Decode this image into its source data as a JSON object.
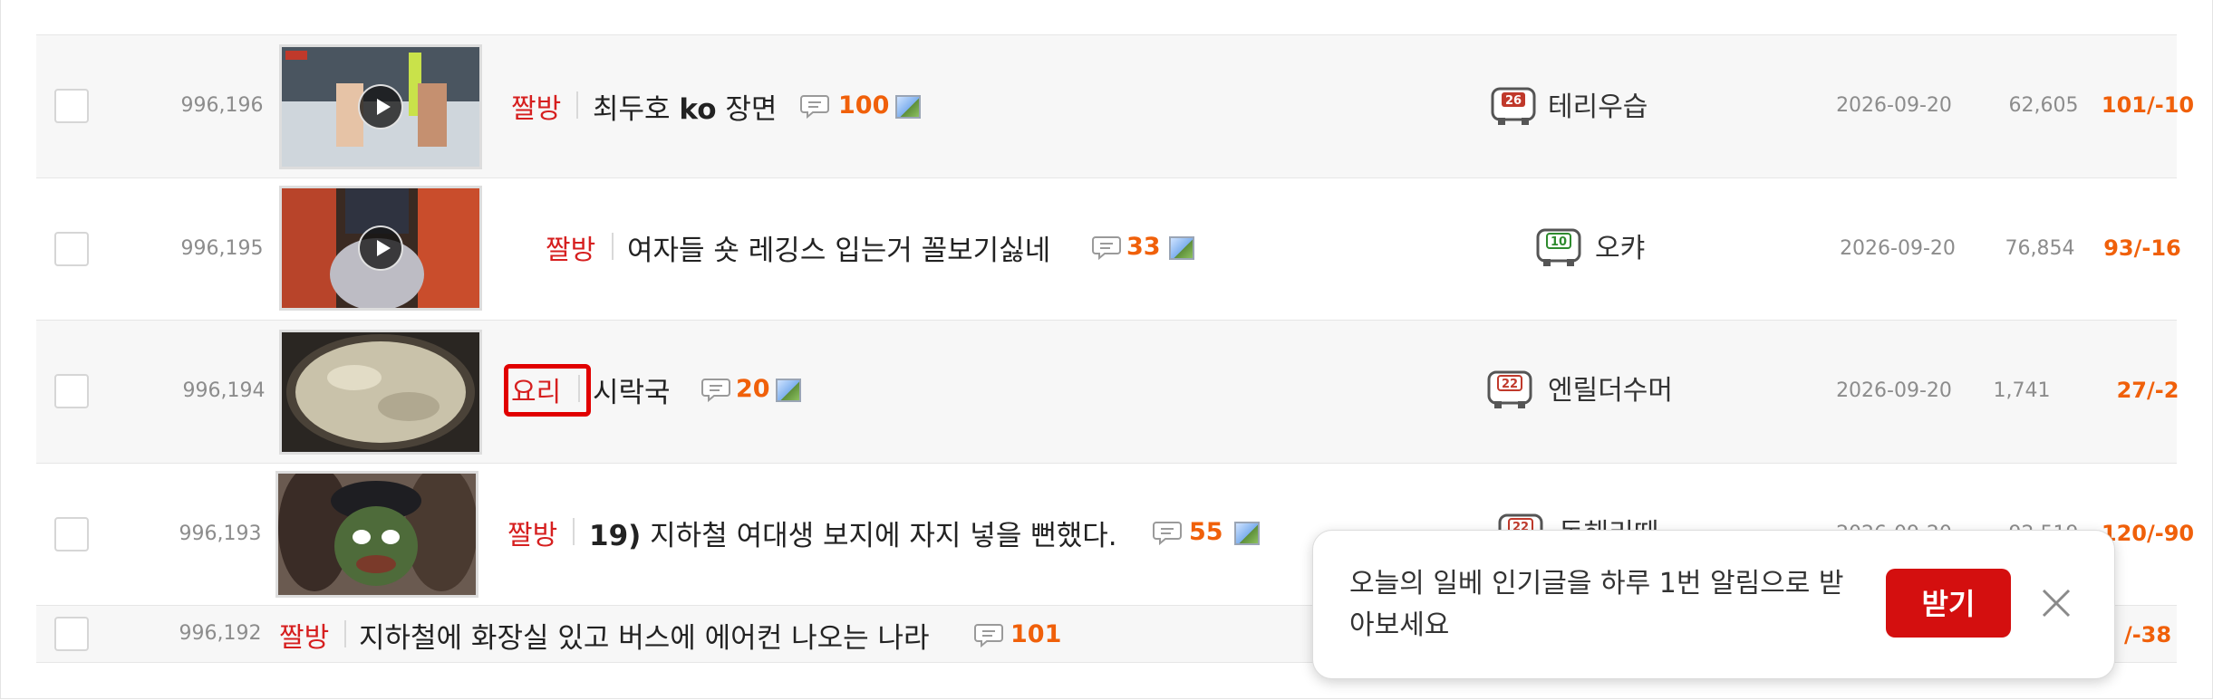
{
  "posts": [
    {
      "number": "996,196",
      "category": "짤방",
      "title_parts": [
        {
          "text": "최두호 ",
          "bold": false
        },
        {
          "text": "ko",
          "bold": true
        },
        {
          "text": " 장면",
          "bold": false
        }
      ],
      "comments": "100",
      "has_image": true,
      "thumb": "ufc-fight",
      "has_video": true,
      "level": "26",
      "level_color": "#c0392b",
      "nickname": "테리우습",
      "date": "2026-09-20",
      "views": "62,605",
      "votes": "101/-10"
    },
    {
      "number": "996,195",
      "category": "짤방",
      "title_parts": [
        {
          "text": "여자들 숏 레깅스 입는거 꼴보기싫네",
          "bold": false
        }
      ],
      "comments": "33",
      "has_image": true,
      "thumb": "gym-photo",
      "has_video": true,
      "level": "10",
      "level_color": "#2e8b2e",
      "nickname": "오캬",
      "date": "2026-09-20",
      "views": "76,854",
      "votes": "93/-16"
    },
    {
      "number": "996,194",
      "category": "요리",
      "title_parts": [
        {
          "text": "시락국",
          "bold": false
        }
      ],
      "comments": "20",
      "has_image": true,
      "thumb": "soup-pan",
      "has_video": false,
      "level": "22",
      "level_color": "#c0392b",
      "nickname": "엔릴더수머",
      "date": "2026-09-20",
      "views": "1,741",
      "votes": "27/-2"
    },
    {
      "number": "996,193",
      "category": "짤방",
      "title_parts": [
        {
          "text": "19)",
          "bold": true
        },
        {
          "text": " 지하철 여대생 보지에 자지 넣을 뻔했다.",
          "bold": false
        }
      ],
      "comments": "55",
      "has_image": true,
      "thumb": "pepe-cartoon",
      "has_video": false,
      "level": "22",
      "level_color": "#c0392b",
      "nickname": "동해리때",
      "date": "2026-09-20",
      "views": "92,519",
      "votes": "120/-90"
    },
    {
      "number": "996,192",
      "category": "짤방",
      "title_parts": [
        {
          "text": "지하철에 화장실 있고 버스에 에어컨 나오는 나라",
          "bold": false
        }
      ],
      "comments": "101",
      "has_image": false,
      "thumb": "",
      "has_video": false,
      "level": "",
      "level_color": "",
      "nickname": "",
      "date": "",
      "views": "",
      "votes": "/-38"
    }
  ],
  "popup": {
    "message": "오늘의 일베 인기글을 하루 1번 알림으로 받아보세요",
    "accept_label": "받기",
    "close_icon": "close-x-icon"
  },
  "colors": {
    "category": "#d61f1f",
    "accent": "#f0600a",
    "popup_button": "#d40f0f",
    "highlight": "#e10000"
  }
}
